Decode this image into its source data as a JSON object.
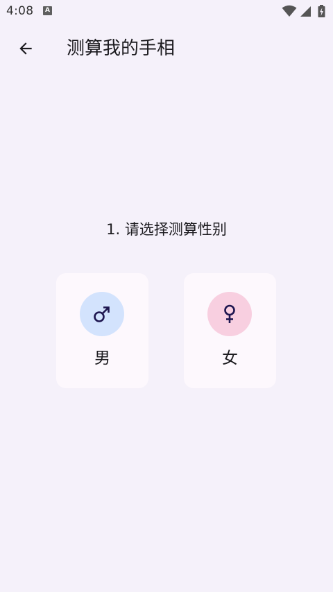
{
  "status_bar": {
    "time": "4:08",
    "notification_badge": "A",
    "icons": [
      "wifi-icon",
      "cellular-signal-icon",
      "battery-charging-icon"
    ]
  },
  "app_bar": {
    "back_icon": "arrow-back-icon",
    "title": "测算我的手相"
  },
  "question": {
    "text": "1. 请选择测算性别"
  },
  "options": [
    {
      "label": "男",
      "icon": "male-symbol-icon",
      "circle_color": "#d3e3fd",
      "icon_color": "#1e1650"
    },
    {
      "label": "女",
      "icon": "female-symbol-icon",
      "circle_color": "#f8cfe0",
      "icon_color": "#1e1650"
    }
  ],
  "colors": {
    "background": "#f5f1fa",
    "card": "#fdf8fd",
    "text": "#1c1b1f"
  }
}
